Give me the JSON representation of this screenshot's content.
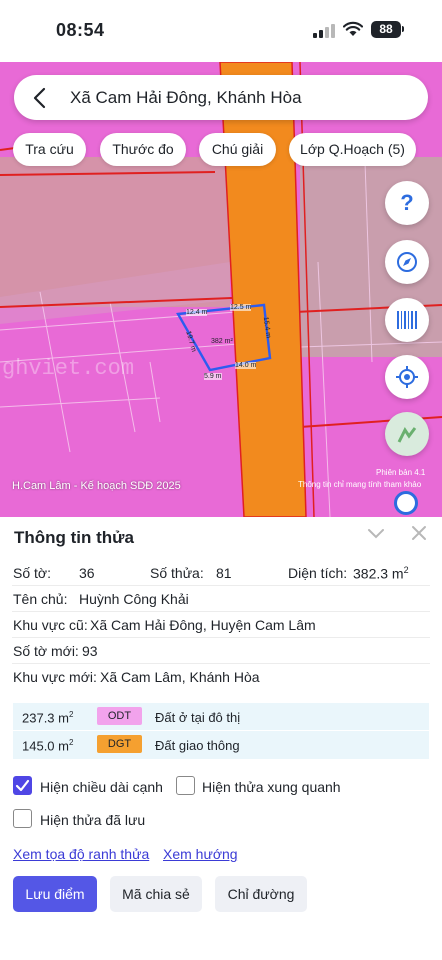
{
  "status": {
    "time": "08:54",
    "battery": "88"
  },
  "search": {
    "text": "Xã Cam Hải Đông, Khánh Hòa"
  },
  "chips": [
    {
      "label": "Tra cứu"
    },
    {
      "label": "Thước đo"
    },
    {
      "label": "Chú giải"
    },
    {
      "label": "Lớp Q.Hoạch (5)"
    }
  ],
  "map": {
    "watermark": "ghviet.com",
    "parcel_area": "382 m²",
    "edges": [
      "12.4 m",
      "12.5 m",
      "15.4 m",
      "14.0 m",
      "5.9 m",
      "19.7 m"
    ],
    "caption": "H.Cam Lâm - Kế hoạch SDĐ 2025",
    "version": "Phiên bản 4.1",
    "note": "Thông tin chỉ mang tính tham khảo",
    "colors": {
      "residential": "#e86ad6",
      "traffic": "#f28a1e",
      "boundary": "#e02020"
    }
  },
  "panel": {
    "title": "Thông tin thửa",
    "so_to_label": "Số tờ:",
    "so_to_value": "36",
    "so_thua_label": "Số thửa:",
    "so_thua_value": "81",
    "dien_tich_label": "Diện tích:",
    "dien_tich_value": "382.3 m",
    "dien_tich_sup": "2",
    "ten_chu_label": "Tên chủ:",
    "ten_chu_value": "Huỳnh Công Khải",
    "kv_cu_label": "Khu vực cũ:",
    "kv_cu_value": "Xã Cam Hải Đông, Huyện Cam Lâm",
    "so_to_moi_label": "Số tờ mới:",
    "so_to_moi_value": "93",
    "kv_moi_label": "Khu vực mới:",
    "kv_moi_value": "Xã Cam Lâm, Khánh Hòa",
    "land_use": [
      {
        "area": "237.3 m",
        "sup": "2",
        "code": "ODT",
        "desc": "Đất ở tại đô thị",
        "color": "#f2a3ec"
      },
      {
        "area": "145.0 m",
        "sup": "2",
        "code": "DGT",
        "desc": "Đất giao thông",
        "color": "#f5a030"
      }
    ],
    "checkboxes": [
      {
        "label": "Hiện chiều dài cạnh",
        "checked": true
      },
      {
        "label": "Hiện thửa xung quanh",
        "checked": false
      },
      {
        "label": "Hiện thửa đã lưu",
        "checked": false
      }
    ],
    "links": [
      {
        "label": "Xem tọa độ ranh thửa"
      },
      {
        "label": "Xem hướng"
      }
    ],
    "buttons": [
      {
        "label": "Lưu điểm"
      },
      {
        "label": "Mã chia sẻ"
      },
      {
        "label": "Chỉ đường"
      }
    ]
  }
}
